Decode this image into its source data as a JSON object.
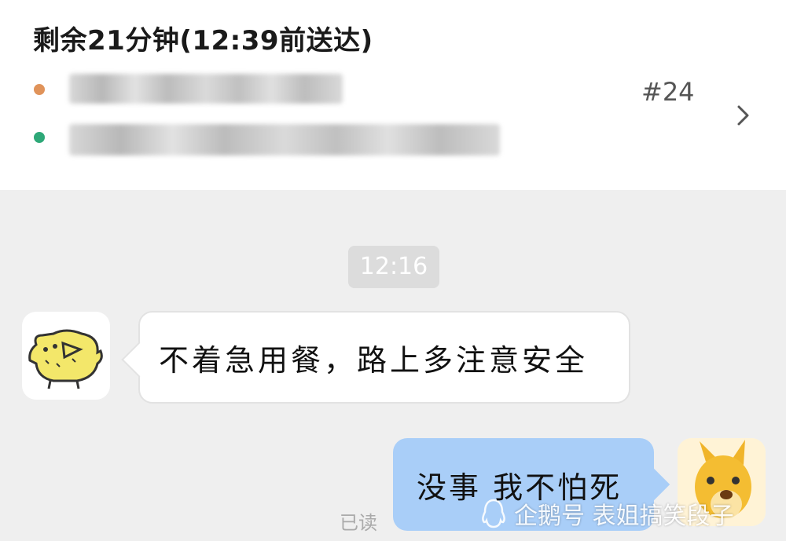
{
  "order": {
    "title": "剩余21分钟(12:39前送达)",
    "number": "#24"
  },
  "chat": {
    "timestamp": "12:16",
    "messages": [
      {
        "sender": "other",
        "text": "不着急用餐，路上多注意安全"
      },
      {
        "sender": "me",
        "text": "没事 我不怕死",
        "status": "已读"
      }
    ]
  },
  "watermark": {
    "text": "企鹅号 表姐搞笑段子"
  },
  "colors": {
    "pickup_dot": "#e0935a",
    "dropoff_dot": "#2ea878",
    "my_bubble": "#a9cef8",
    "background": "#efefef"
  },
  "icons": [
    "chevron-right-icon",
    "chick-avatar-icon",
    "kangaroo-avatar-icon",
    "penguin-icon"
  ]
}
